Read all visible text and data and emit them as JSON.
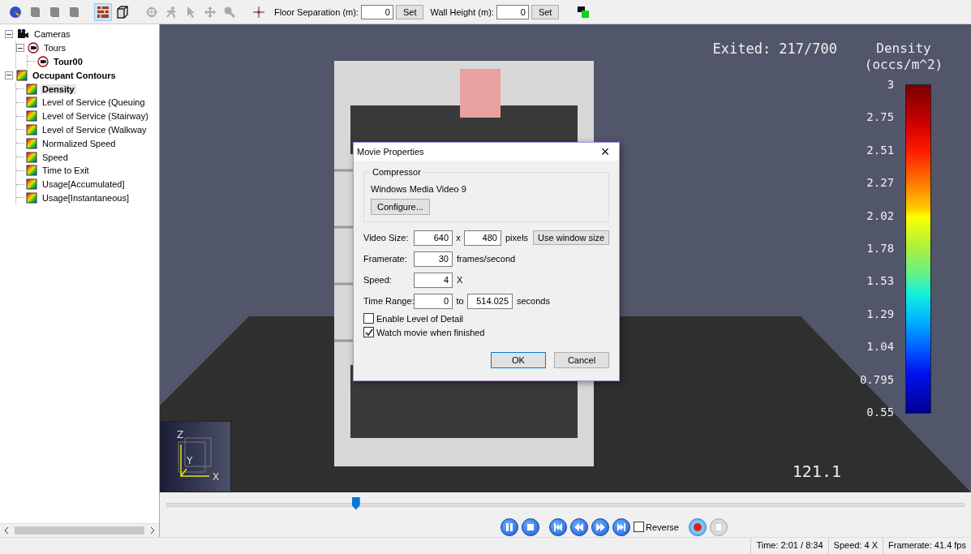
{
  "toolbar": {
    "tools": [
      {
        "kind": "globe",
        "selected": false
      },
      {
        "kind": "shape",
        "selected": false
      },
      {
        "kind": "shape",
        "selected": false
      },
      {
        "kind": "shape",
        "selected": false
      },
      {
        "kind": "texture",
        "selected": true
      },
      {
        "kind": "cube",
        "selected": false
      },
      {
        "kind": "orbit",
        "selected": false
      },
      {
        "kind": "walk",
        "selected": false
      },
      {
        "kind": "pointer",
        "selected": false
      },
      {
        "kind": "move",
        "selected": false
      },
      {
        "kind": "zoom",
        "selected": false
      },
      {
        "kind": "center",
        "selected": false
      }
    ],
    "fields": [
      {
        "label": "Floor Separation (m):",
        "value": "0",
        "button": "Set"
      },
      {
        "label": "Wall Height (m):",
        "value": "0",
        "button": "Set"
      }
    ]
  },
  "tree": [
    {
      "label": "Cameras",
      "kind": "camera",
      "active": false,
      "selected": false,
      "expanded": true,
      "children": [
        {
          "label": "Tours",
          "kind": "tour",
          "active": false,
          "selected": false,
          "expanded": true,
          "children": [
            {
              "label": "Tour00",
              "kind": "tour",
              "active": true,
              "selected": false
            }
          ]
        }
      ]
    },
    {
      "label": "Occupant Contours",
      "kind": "contour",
      "active": true,
      "selected": false,
      "expanded": true,
      "children": [
        {
          "label": "Density",
          "kind": "contour",
          "active": true,
          "selected": true
        },
        {
          "label": "Level of Service (Queuing",
          "kind": "contour",
          "active": false,
          "selected": false
        },
        {
          "label": "Level of Service (Stairway)",
          "kind": "contour",
          "active": false,
          "selected": false
        },
        {
          "label": "Level of Service (Walkway",
          "kind": "contour",
          "active": false,
          "selected": false
        },
        {
          "label": "Normalized Speed",
          "kind": "contour",
          "active": false,
          "selected": false
        },
        {
          "label": "Speed",
          "kind": "contour",
          "active": false,
          "selected": false
        },
        {
          "label": "Time to Exit",
          "kind": "contour",
          "active": false,
          "selected": false
        },
        {
          "label": "Usage[Accumulated]",
          "kind": "contour",
          "active": false,
          "selected": false
        },
        {
          "label": "Usage[Instantaneous]",
          "kind": "contour",
          "active": false,
          "selected": false
        }
      ]
    }
  ],
  "viewport": {
    "exited": "Exited: 217/700",
    "legend_title": [
      "Density",
      "(occs/m^2)"
    ],
    "legend_ticks": [
      "3",
      "2.75",
      "2.51",
      "2.27",
      "2.02",
      "1.78",
      "1.53",
      "1.29",
      "1.04",
      "0.795",
      "0.55"
    ],
    "clock": "121.1",
    "axes": [
      "Z",
      "Y",
      "X"
    ]
  },
  "timeline": {
    "level": 0.237
  },
  "playback": {
    "buttons": [
      {
        "kind": "pause"
      },
      {
        "kind": "stop"
      },
      {
        "kind": "first"
      },
      {
        "kind": "rewind"
      },
      {
        "kind": "forward"
      },
      {
        "kind": "last"
      }
    ],
    "reverse": {
      "label": "Reverse",
      "checked": false
    },
    "record": [
      {
        "kind": "record"
      },
      {
        "kind": "record-stop"
      }
    ]
  },
  "status_bar": [
    "Time: 2:01 / 8:34",
    "Speed: 4 X",
    "Framerate: 41.4 fps"
  ],
  "dialog": {
    "title": "Movie Properties",
    "close": "×",
    "group": "Compressor",
    "codec": "Windows Media Video 9",
    "configure": "Configure...",
    "rows": [
      {
        "label": "Video Size:",
        "value": "640",
        "sep": "x",
        "value2": "480",
        "unit": "pixels",
        "button": "Use window size"
      },
      {
        "label": "Framerate:",
        "value": "30",
        "unit": "frames/second"
      },
      {
        "label": "Speed:",
        "value": "4",
        "unit": "X"
      },
      {
        "label": "Time Range:",
        "value": "0",
        "sep": "to",
        "value2": "514.025",
        "unit": "seconds"
      }
    ],
    "checks": [
      {
        "label": "Enable Level of Detail",
        "checked": false
      },
      {
        "label": "Watch movie when finished",
        "checked": true
      }
    ],
    "ok": "OK",
    "cancel": "Cancel"
  }
}
